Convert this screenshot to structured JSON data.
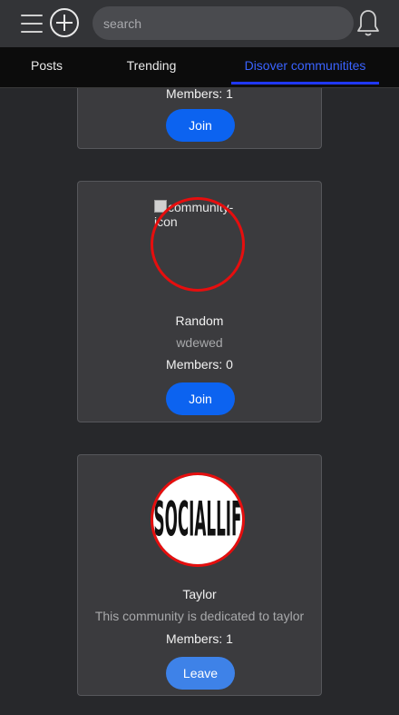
{
  "header": {
    "search_placeholder": "search",
    "menu_icon": "hamburger-menu-icon",
    "create_icon": "plus-circle-icon",
    "notifications_icon": "bell-icon"
  },
  "tabs": [
    {
      "label": "Posts",
      "active": false
    },
    {
      "label": "Trending",
      "active": false
    },
    {
      "label": "Disover communitites",
      "active": true
    }
  ],
  "colors": {
    "accent": "#0c63f0",
    "active_tab": "#3a63ff",
    "icon_ring": "#e60e0e"
  },
  "communities": [
    {
      "members": "Members: 1",
      "action": "Join"
    },
    {
      "icon_alt": "community-icon",
      "name": "Random",
      "description": "wdewed",
      "members": "Members: 0",
      "action": "Join"
    },
    {
      "icon_text": "SOCIALLIF",
      "name": "Taylor",
      "description": "This community is dedicated to taylor",
      "members": "Members: 1",
      "action": "Leave"
    }
  ]
}
